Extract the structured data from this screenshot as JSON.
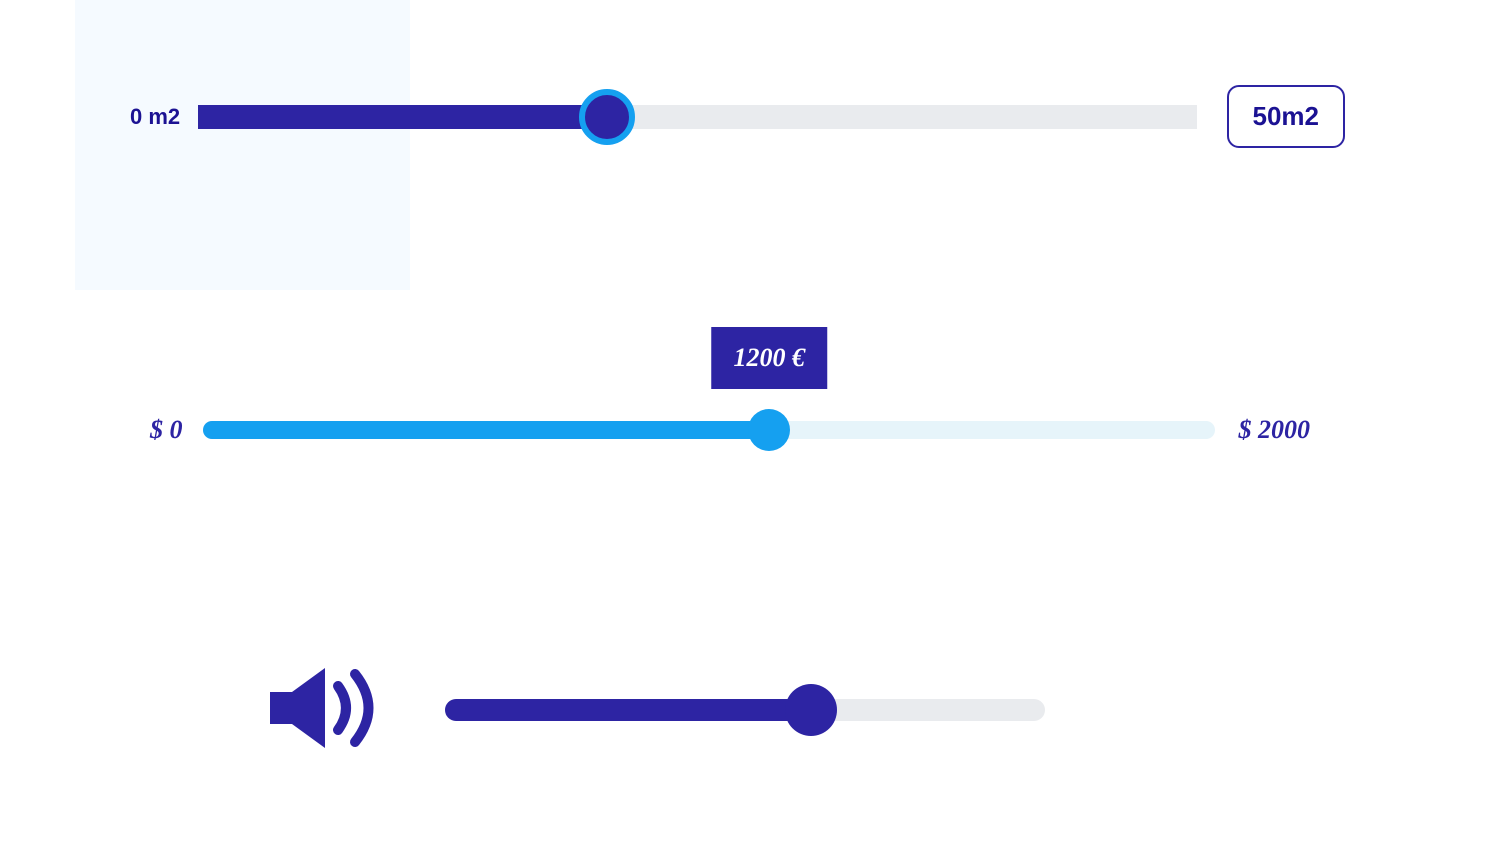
{
  "slider_area": {
    "min_label": "0 m2",
    "max_label": "50m2",
    "value": 20,
    "min": 0,
    "max": 50,
    "fill_percent": 41
  },
  "slider_price": {
    "min_label": "$ 0",
    "max_label": "$ 2000",
    "tooltip": "1200 €",
    "value": 1200,
    "min": 0,
    "max": 2000,
    "fill_percent": 56
  },
  "slider_volume": {
    "icon": "volume-icon",
    "value": 61,
    "min": 0,
    "max": 100,
    "fill_percent": 61
  },
  "colors": {
    "indigo": "#2d24a3",
    "sky": "#15a0f0",
    "track_grey": "#e9ebee",
    "track_pale": "#e6f4fa"
  }
}
